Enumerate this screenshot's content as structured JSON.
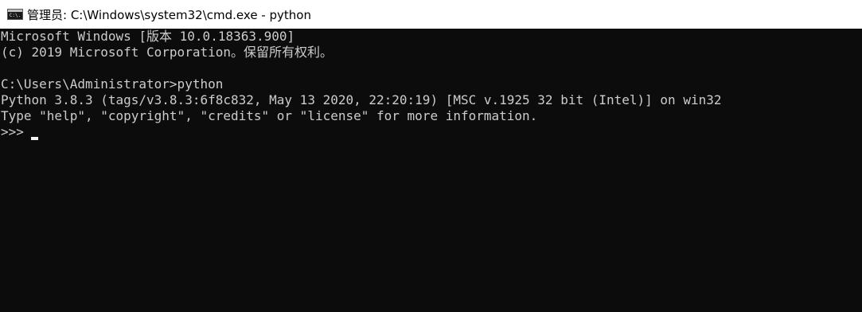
{
  "window": {
    "title": "管理员: C:\\Windows\\system32\\cmd.exe - python",
    "icon": "command-prompt-icon",
    "icon_text": "C:\\."
  },
  "console": {
    "lines": [
      "Microsoft Windows [版本 10.0.18363.900]",
      "(c) 2019 Microsoft Corporation。保留所有权利。",
      "",
      "C:\\Users\\Administrator>python",
      "Python 3.8.3 (tags/v3.8.3:6f8c832, May 13 2020, 22:20:19) [MSC v.1925 32 bit (Intel)] on win32",
      "Type \"help\", \"copyright\", \"credits\" or \"license\" for more information."
    ],
    "prompt": ">>>"
  },
  "colors": {
    "background": "#0c0c0c",
    "foreground": "#cccccc",
    "titlebar": "#ffffff"
  }
}
